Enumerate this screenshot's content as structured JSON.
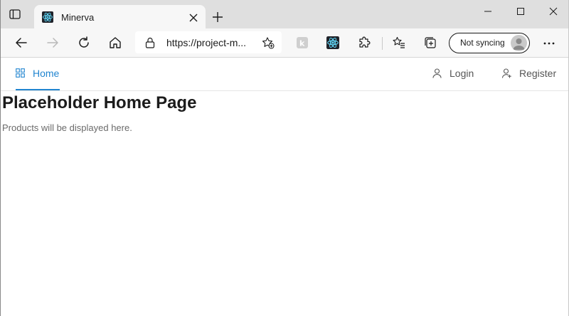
{
  "browser": {
    "tab": {
      "title": "Minerva",
      "favicon": "react-icon"
    },
    "address": {
      "url": "https://project-m..."
    },
    "profile": {
      "sync_label": "Not syncing"
    },
    "colors": {
      "accent": "#2185d0",
      "tab_strip": "#dfdfdf",
      "toolbar": "#f7f7f7"
    }
  },
  "nav": {
    "home_label": "Home",
    "login_label": "Login",
    "register_label": "Register"
  },
  "main": {
    "title": "Placeholder Home Page",
    "subtitle": "Products will be displayed here."
  }
}
